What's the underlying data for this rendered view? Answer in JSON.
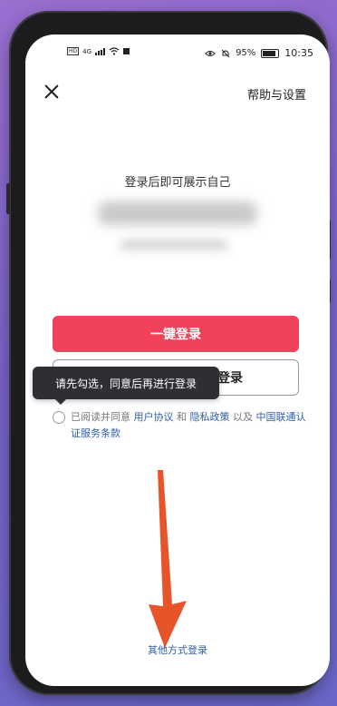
{
  "status_bar": {
    "hd": "HD",
    "signal": "4G",
    "battery_percent": "95%",
    "time": "10:35"
  },
  "header": {
    "help_settings": "帮助与设置"
  },
  "main": {
    "heading": "登录后即可展示自己",
    "primary_button": "一键登录",
    "secondary_button_visible": "登录",
    "tooltip": "请先勾选，同意后再进行登录"
  },
  "agreement": {
    "prefix": "已阅读并同意 ",
    "user_agreement": "用户协议",
    "and": " 和 ",
    "privacy_policy": "隐私政策",
    "and_also": " 以及 ",
    "carrier_terms": "中国联通认证服务条款"
  },
  "footer": {
    "other_login": "其他方式登录"
  },
  "colors": {
    "primary": "#f2415a",
    "link": "#2f5ea8",
    "arrow": "#e8542a"
  }
}
